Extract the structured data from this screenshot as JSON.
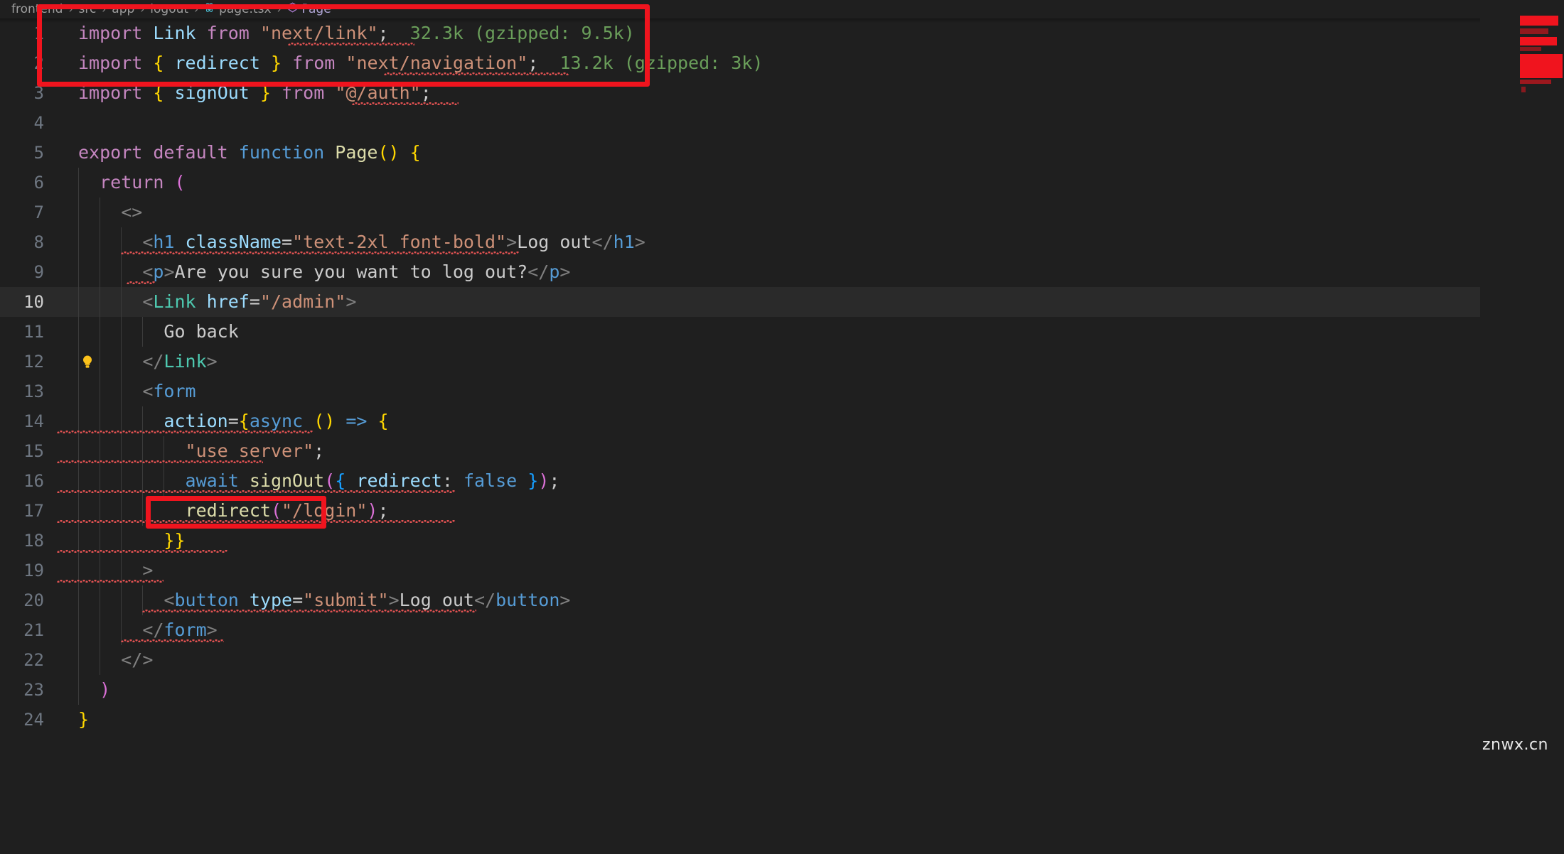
{
  "window": {
    "theme_background": "#1f1f1f",
    "accent_annotation_color": "#f0141e"
  },
  "breadcrumb": {
    "items": [
      {
        "label": "frontend",
        "icon": ""
      },
      {
        "label": "src",
        "icon": ""
      },
      {
        "label": "app",
        "icon": ""
      },
      {
        "label": "logout",
        "icon": ""
      },
      {
        "label": "page.tsx",
        "icon": "react-file-icon"
      },
      {
        "label": "Page",
        "icon": "symbol-class-icon"
      }
    ],
    "separator": "›"
  },
  "editor": {
    "language": "tsx",
    "active_line": 10,
    "quick_fix_line": 10,
    "quick_fix_icon": "lightbulb-icon",
    "lines": [
      {
        "n": 1,
        "text": "import Link from \"next/link\";"
      },
      {
        "n": 2,
        "text": "import { redirect } from \"next/navigation\";"
      },
      {
        "n": 3,
        "text": "import { signOut } from \"@/auth\";"
      },
      {
        "n": 4,
        "text": ""
      },
      {
        "n": 5,
        "text": "export default function Page() {"
      },
      {
        "n": 6,
        "text": "  return ("
      },
      {
        "n": 7,
        "text": "    <>"
      },
      {
        "n": 8,
        "text": "      <h1 className=\"text-2xl font-bold\">Log out</h1>"
      },
      {
        "n": 9,
        "text": "      <p>Are you sure you want to log out?</p>"
      },
      {
        "n": 10,
        "text": "      <Link href=\"/admin\">"
      },
      {
        "n": 11,
        "text": "        Go back"
      },
      {
        "n": 12,
        "text": "      </Link>"
      },
      {
        "n": 13,
        "text": "      <form"
      },
      {
        "n": 14,
        "text": "        action={async () => {"
      },
      {
        "n": 15,
        "text": "          \"use server\";"
      },
      {
        "n": 16,
        "text": "          await signOut({ redirect: false });"
      },
      {
        "n": 17,
        "text": "          redirect(\"/login\");"
      },
      {
        "n": 18,
        "text": "        }}"
      },
      {
        "n": 19,
        "text": "      >"
      },
      {
        "n": 20,
        "text": "        <button type=\"submit\">Log out</button>"
      },
      {
        "n": 21,
        "text": "      </form>"
      },
      {
        "n": 22,
        "text": "    </>"
      },
      {
        "n": 23,
        "text": "  )"
      },
      {
        "n": 24,
        "text": "}"
      }
    ],
    "import_cost_annotations": [
      {
        "line": 1,
        "text": "32.3k (gzipped: 9.5k)"
      },
      {
        "line": 2,
        "text": "13.2k (gzipped: 3k)"
      }
    ]
  },
  "annotations": [
    {
      "name": "imports-highlight",
      "target_lines": "1-3"
    },
    {
      "name": "redirect-highlight",
      "target_lines": "17"
    }
  ],
  "watermark": {
    "text": "znwx.cn"
  }
}
